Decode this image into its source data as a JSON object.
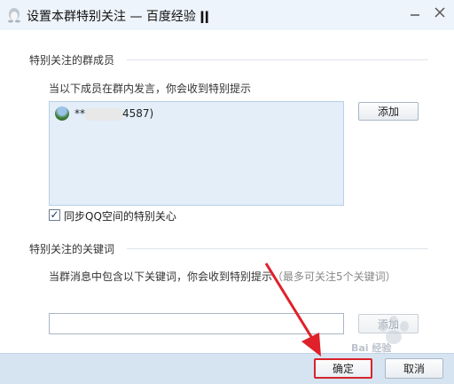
{
  "window": {
    "title": "设置本群特别关注 — 百度经验",
    "title_suffix_glyph": "ǀǀ"
  },
  "members_section": {
    "title": "特别关注的群成员",
    "hint": "当以下成员在群内发言，你会收到特别提示",
    "members": [
      {
        "name_prefix": "**",
        "name_suffix": "4587)"
      }
    ],
    "add_button": "添加",
    "sync_checkbox": {
      "label": "同步QQ空间的特别关心",
      "checked": true
    }
  },
  "keywords_section": {
    "title": "特别关注的关键词",
    "hint_main": "当群消息中包含以下关键词，你会收到特别提示",
    "hint_note": "（最多可关注5个关键词）",
    "input_value": "",
    "add_button": "添加"
  },
  "footer": {
    "ok_button": "确定",
    "cancel_button": "取消"
  },
  "watermark": {
    "text": "Bai 经验"
  },
  "colors": {
    "annotation_arrow": "#e0202a",
    "list_bg": "#e3eef9",
    "footer_bg": "#d6e4f2"
  }
}
